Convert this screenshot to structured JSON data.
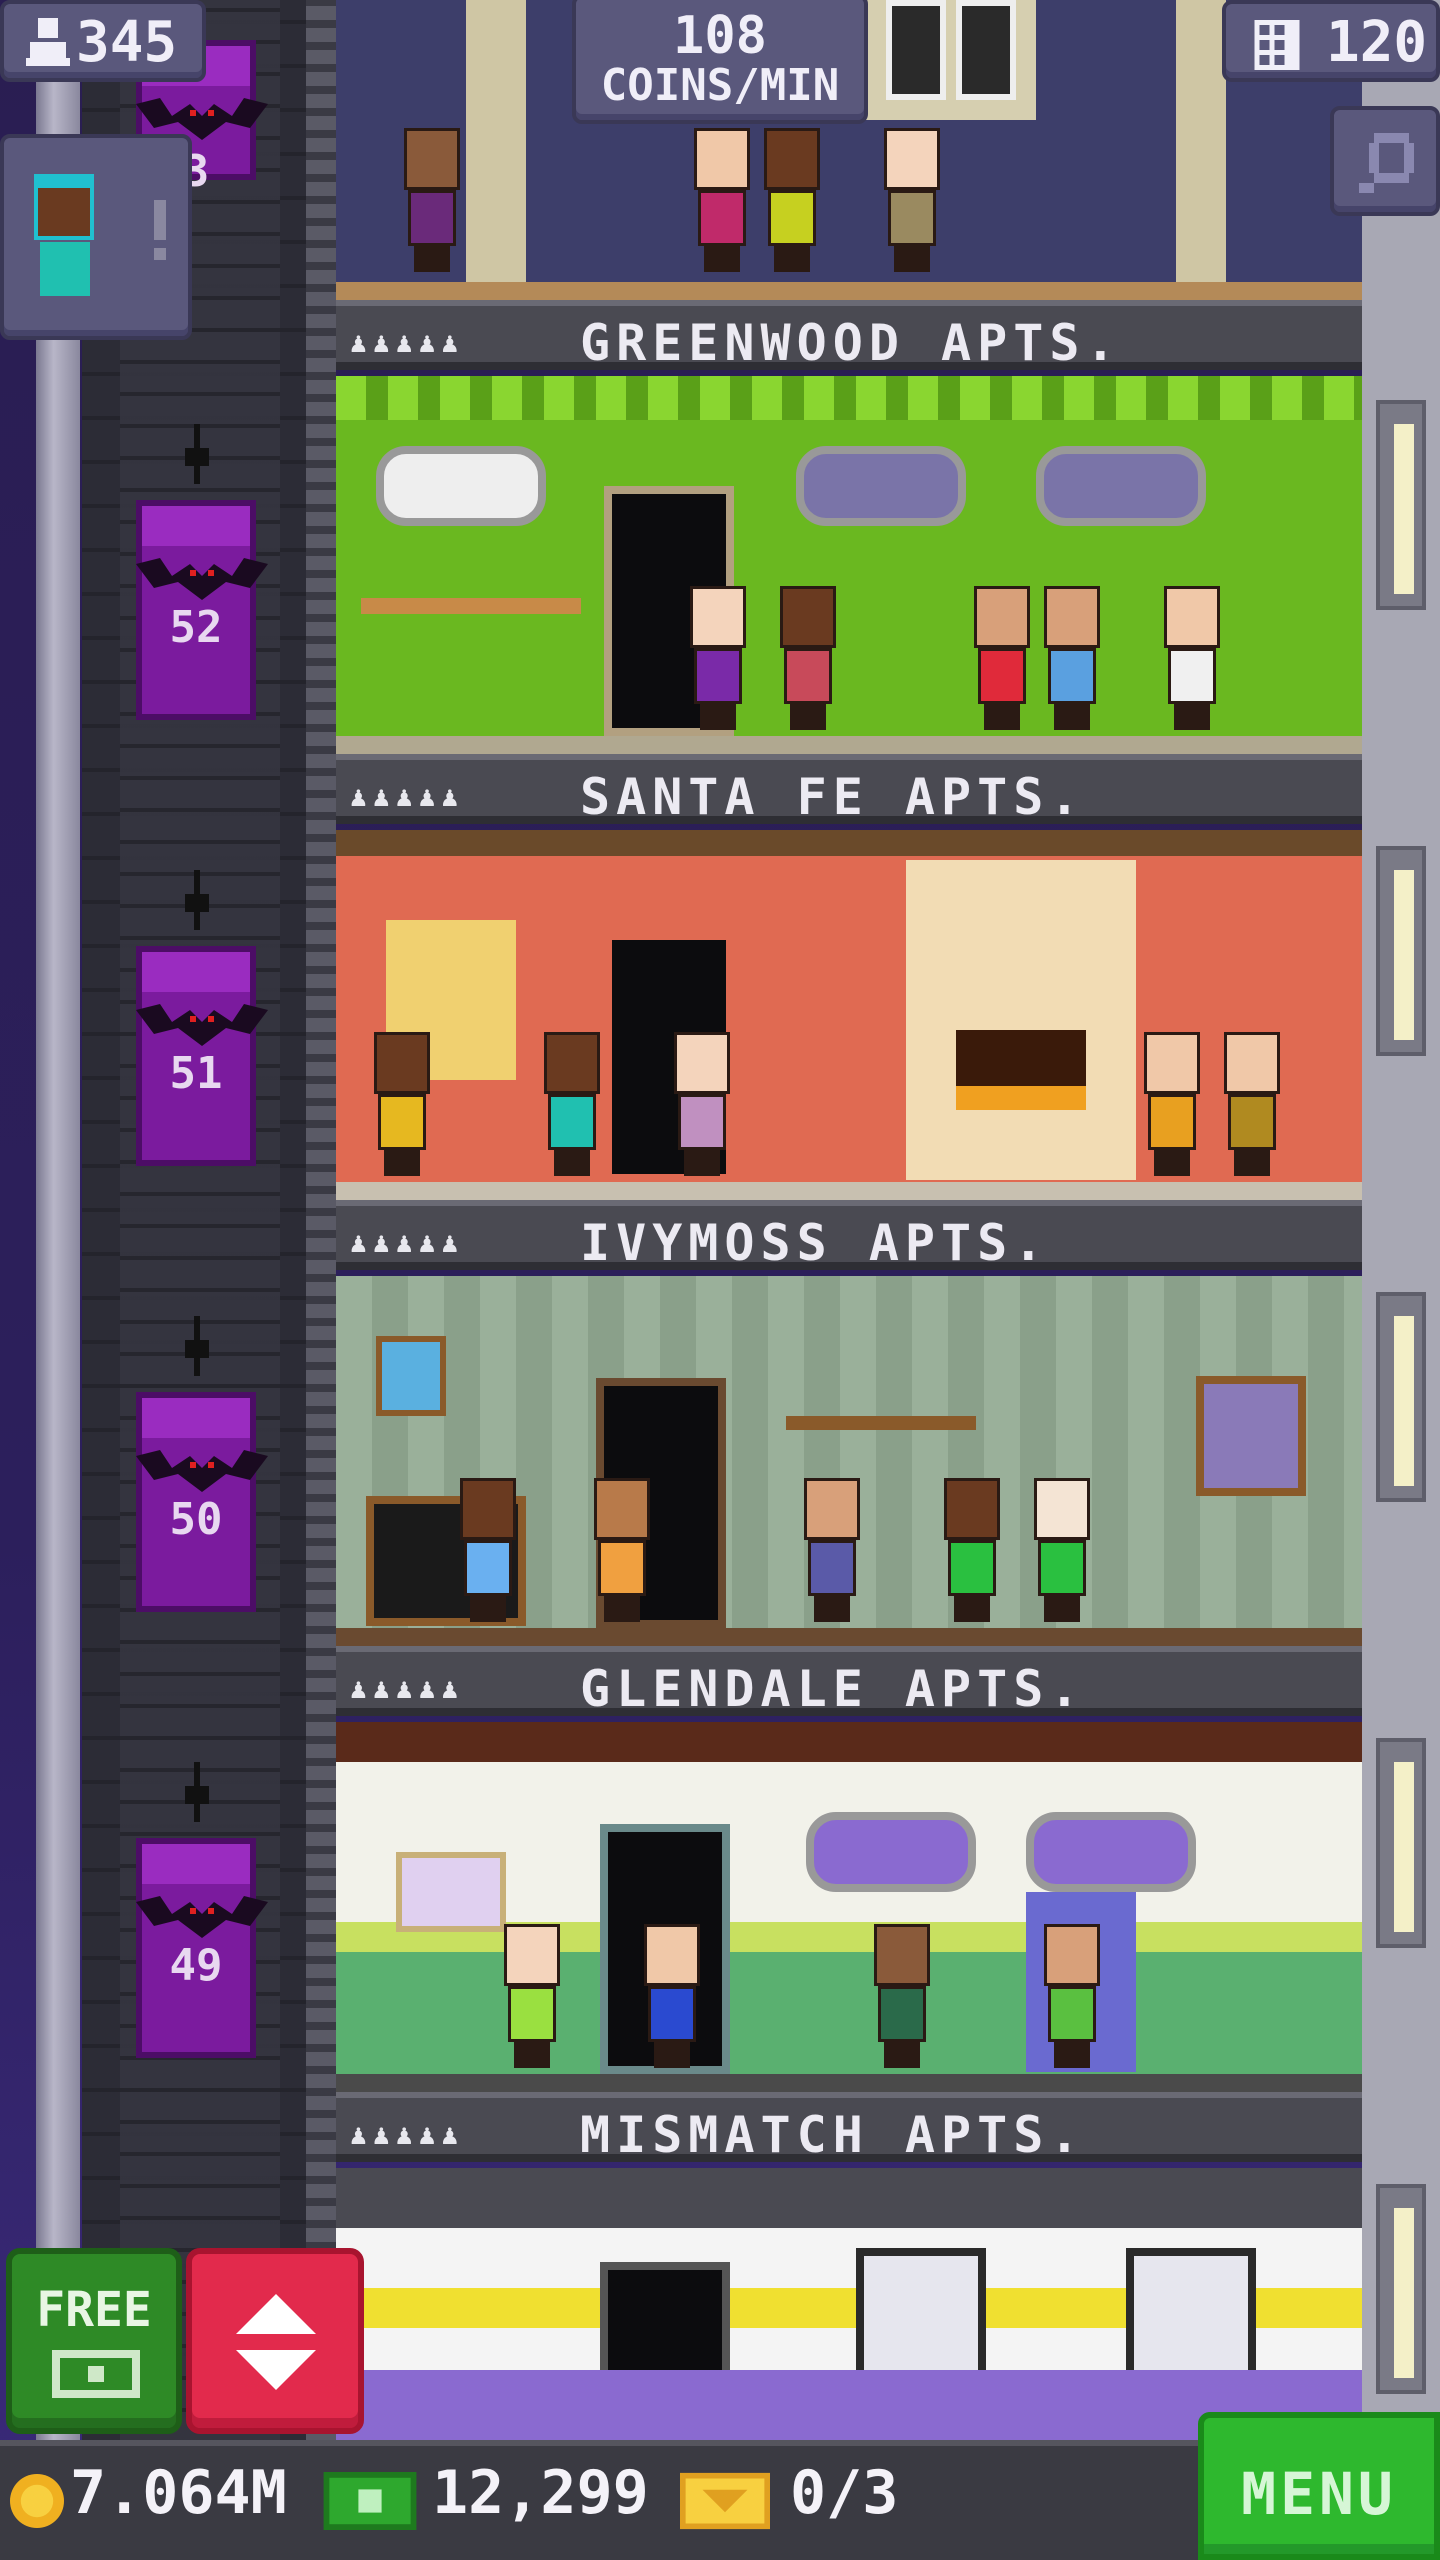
{
  "hud": {
    "population": "345",
    "coins_rate_value": "108",
    "coins_rate_unit": "COINS/MIN",
    "floor_count": "120"
  },
  "elevator": {
    "floor_numbers": [
      "3",
      "52",
      "51",
      "50",
      "49"
    ]
  },
  "floors": [
    {
      "name": "GREENWOOD APTS.",
      "residents_indicator": "♟♟♟♟♟"
    },
    {
      "name": "SANTA FE APTS.",
      "residents_indicator": "♟♟♟♟♟"
    },
    {
      "name": "IVYMOSS APTS.",
      "residents_indicator": "♟♟♟♟♟"
    },
    {
      "name": "GLENDALE APTS.",
      "residents_indicator": "♟♟♟♟♟"
    },
    {
      "name": "MISMATCH APTS.",
      "residents_indicator": "♟♟♟♟♟"
    }
  ],
  "buttons": {
    "free_label": "FREE",
    "menu_label": "MENU"
  },
  "currency": {
    "coins": "7.064M",
    "tower_bux": "12,299",
    "vip_tickets": "0/3"
  },
  "icons": {
    "population": "person-icon",
    "floors": "building-grid-icon",
    "search": "magnifier-icon",
    "coins": "coin-icon",
    "bux": "banknote-icon",
    "vip": "ticket-icon",
    "elevator": "up-down-arrows-icon"
  },
  "colors": {
    "menu_green": "#2eb82e",
    "elevator_red": "#e22a4c",
    "elevator_car_purple": "#7b1b9e",
    "hud_panel": "#5a587c"
  }
}
